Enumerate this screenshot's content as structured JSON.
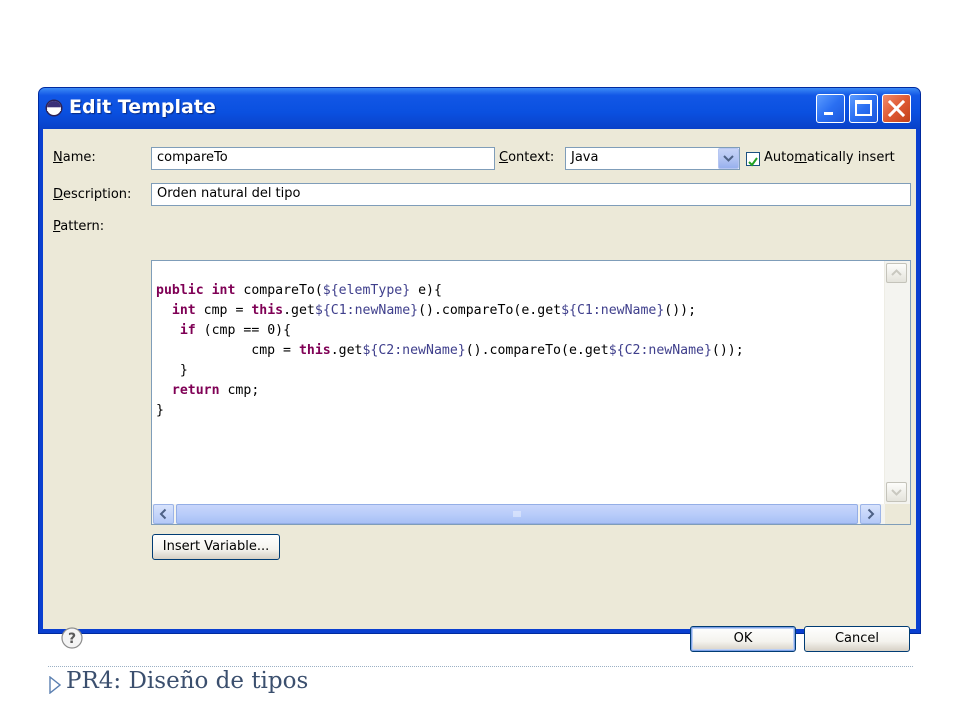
{
  "window": {
    "title": "Edit Template",
    "colors": {
      "titlebar": "#0a50e0",
      "client": "#ece9d8",
      "keyword": "#7f0055"
    }
  },
  "form": {
    "name_label": "Name:",
    "name_value": "compareTo",
    "context_label": "Context:",
    "context_value": "Java",
    "auto_insert_label": "Automatically insert",
    "auto_insert_checked": true,
    "description_label": "Description:",
    "description_value": "Orden natural del tipo",
    "pattern_label": "Pattern:"
  },
  "pattern_lines": [
    "public int compareTo(${elemType} e){",
    "  int cmp = this.get${C1:newName}().compareTo(e.get${C1:newName}());",
    "   if (cmp == 0){",
    "            cmp = this.get${C2:newName}().compareTo(e.get${C2:newName}());",
    "   }",
    "  return cmp;",
    "}"
  ],
  "buttons": {
    "insert_variable": "Insert Variable...",
    "ok": "OK",
    "cancel": "Cancel"
  },
  "icons": {
    "help": "help-icon",
    "minimize": "minimize-icon",
    "maximize": "maximize-icon",
    "close": "close-icon"
  },
  "footer": {
    "text": "PR4: Diseño de tipos"
  }
}
